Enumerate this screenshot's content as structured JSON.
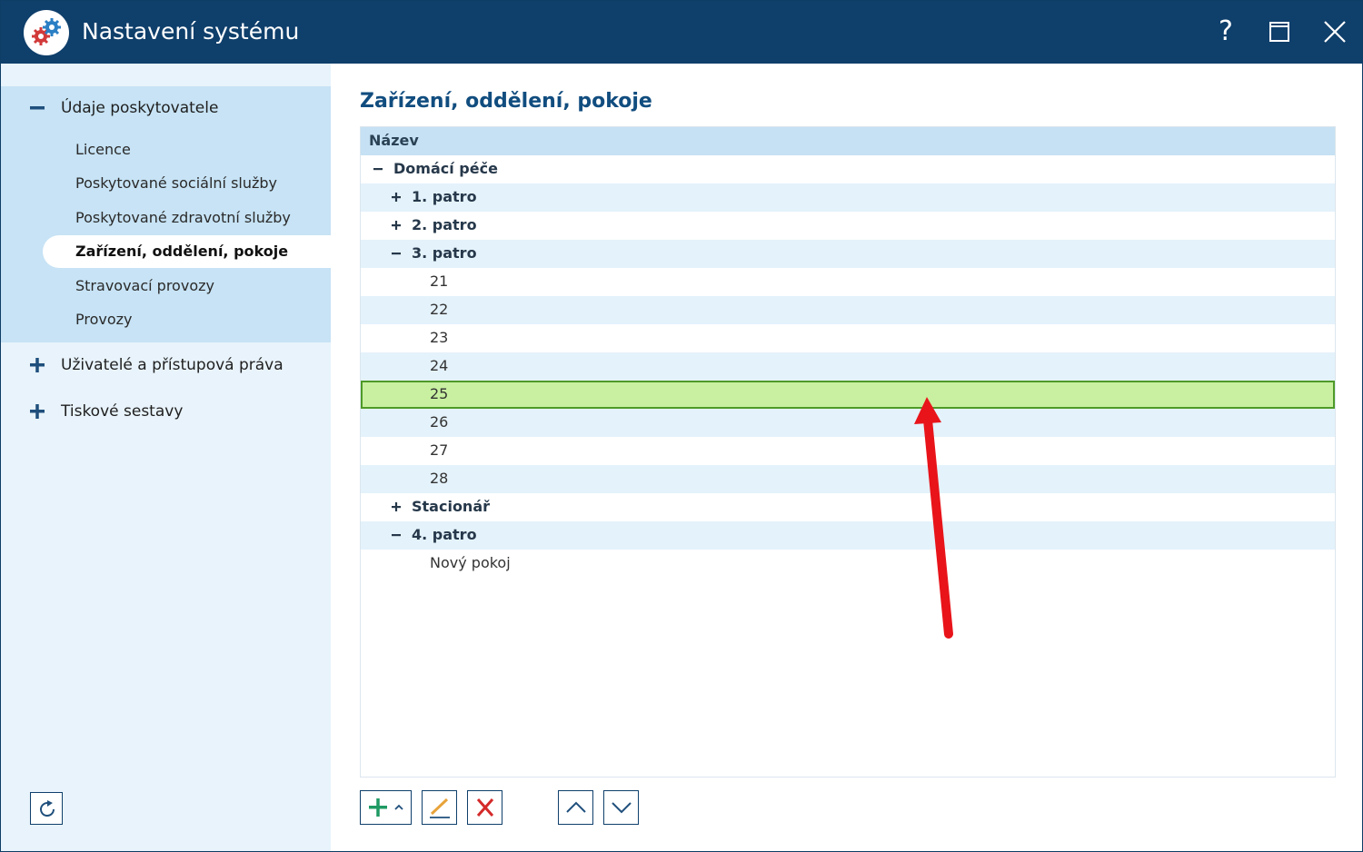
{
  "window": {
    "title": "Nastavení systému",
    "help_label": "?",
    "colors": {
      "titlebar": "#0f3f6b",
      "accent": "#114d7f",
      "selected_row": "#c8f0a0"
    }
  },
  "sidebar": {
    "groups": [
      {
        "label": "Údaje poskytovatele",
        "expanded": true,
        "items": [
          {
            "label": "Licence"
          },
          {
            "label": "Poskytované sociální služby"
          },
          {
            "label": "Poskytované zdravotní služby"
          },
          {
            "label": "Zařízení, oddělení, pokoje",
            "active": true
          },
          {
            "label": "Stravovací provozy"
          },
          {
            "label": "Provozy"
          }
        ]
      },
      {
        "label": "Uživatelé a přístupová práva",
        "expanded": false
      },
      {
        "label": "Tiskové sestavy",
        "expanded": false
      }
    ]
  },
  "main": {
    "title": "Zařízení, oddělení, pokoje",
    "grid": {
      "header": "Název",
      "rows": [
        {
          "label": "Domácí péče",
          "level": 0,
          "toggle": "minus",
          "bold": true
        },
        {
          "label": "1. patro",
          "level": 1,
          "toggle": "plus",
          "bold": true
        },
        {
          "label": "2. patro",
          "level": 1,
          "toggle": "plus",
          "bold": true
        },
        {
          "label": "3. patro",
          "level": 1,
          "toggle": "minus",
          "bold": true
        },
        {
          "label": "21",
          "level": 2
        },
        {
          "label": "22",
          "level": 2
        },
        {
          "label": "23",
          "level": 2
        },
        {
          "label": "24",
          "level": 2
        },
        {
          "label": "25",
          "level": 2,
          "selected": true
        },
        {
          "label": "26",
          "level": 2
        },
        {
          "label": "27",
          "level": 2
        },
        {
          "label": "28",
          "level": 2
        },
        {
          "label": "Stacionář",
          "level": 1,
          "toggle": "plus",
          "bold": true
        },
        {
          "label": "4. patro",
          "level": 1,
          "toggle": "minus",
          "bold": true
        },
        {
          "label": "Nový pokoj",
          "level": 2
        }
      ]
    }
  }
}
